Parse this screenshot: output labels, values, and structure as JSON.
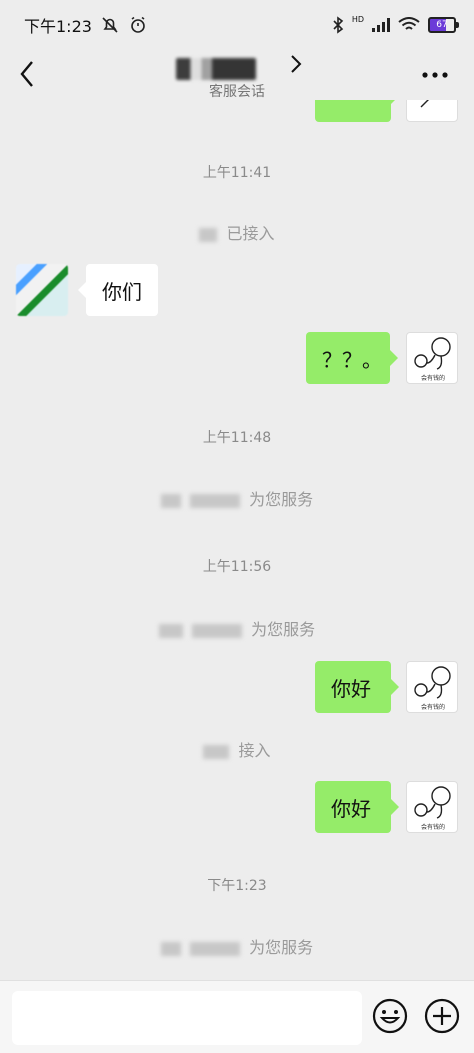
{
  "status_bar": {
    "time": "下午1:23",
    "network_label": "HD",
    "battery_level": "67"
  },
  "nav": {
    "subtitle": "客服会话",
    "back_icon": "chevron-left-icon",
    "more_icon": "more-dots-icon"
  },
  "messages": {
    "time1": "上午11:41",
    "sys1": "已接入",
    "other_msg": "你们",
    "me_msg1": "？？。",
    "time2": "上午11:48",
    "sys2": "为您服务",
    "time3": "上午11:56",
    "sys3": "为您服务",
    "me_msg2": "你好",
    "sys4": "接入",
    "me_msg3": "你好",
    "time4": "下午1:23",
    "sys5": "为您服务",
    "sticker_caption": "会有钱的"
  },
  "input_bar": {
    "placeholder": "",
    "emoji_icon": "smiley-icon",
    "add_icon": "plus-circle-icon"
  }
}
